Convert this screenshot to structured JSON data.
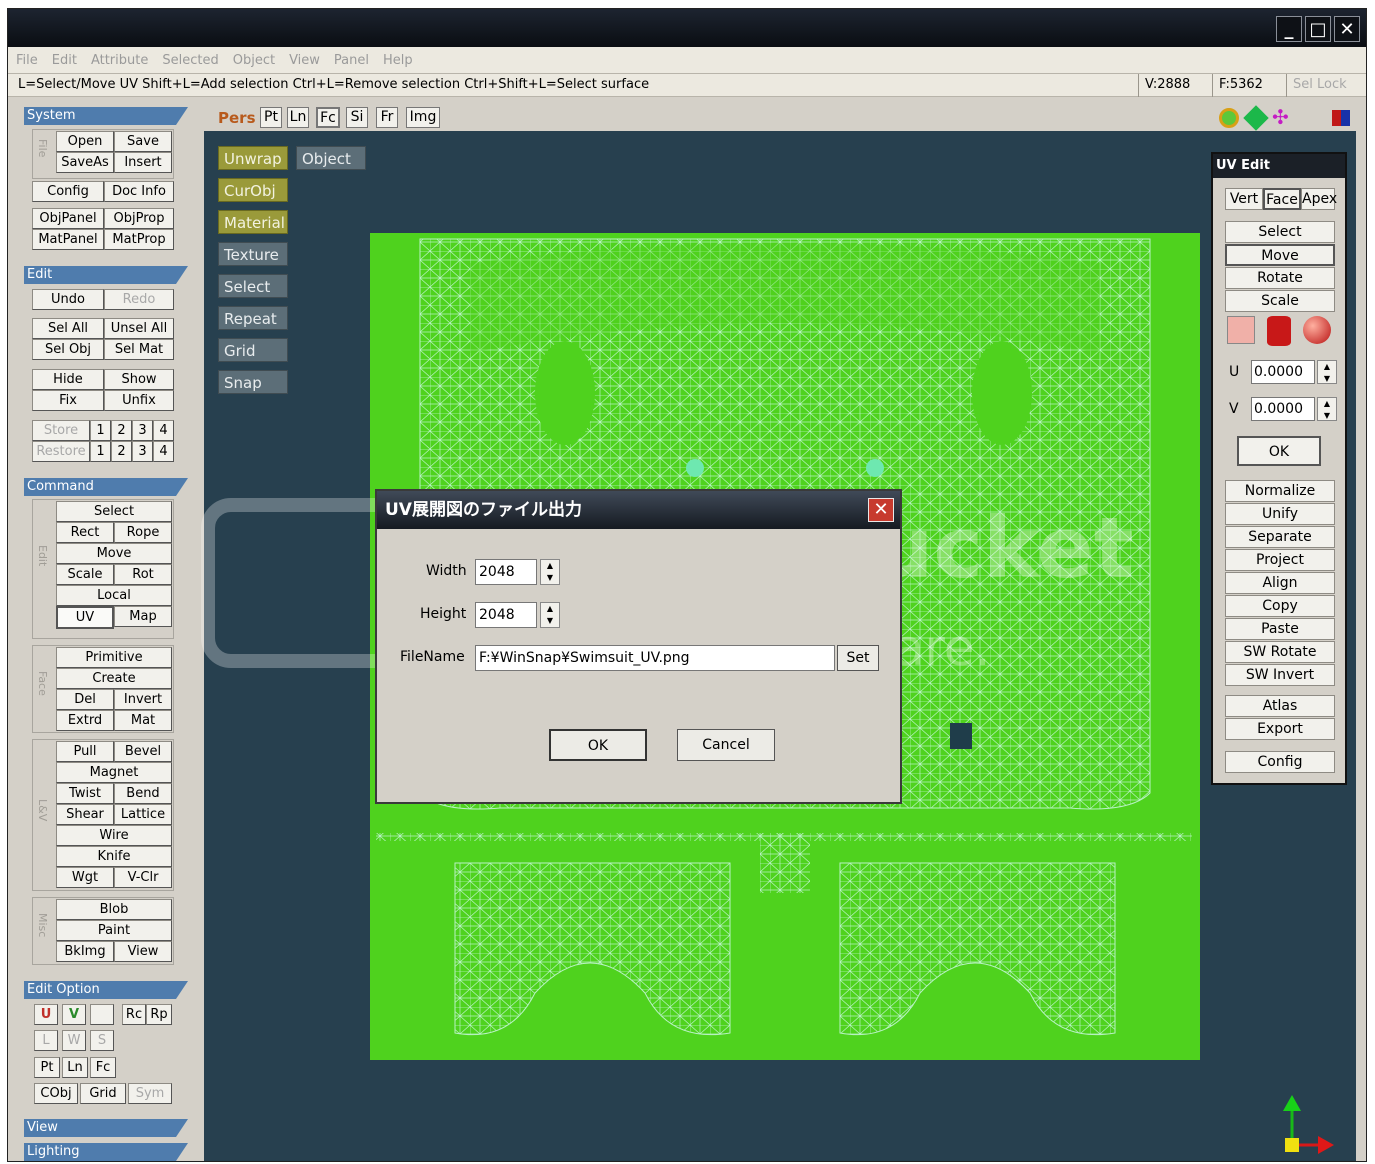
{
  "menu": [
    "File",
    "Edit",
    "Attribute",
    "Selected",
    "Object",
    "View",
    "Panel",
    "Help"
  ],
  "status": {
    "hint": "L=Select/Move UV  Shift+L=Add selection  Ctrl+L=Remove selection  Ctrl+Shift+L=Select surface",
    "verts": "V:2888",
    "faces": "F:5362",
    "lock": "Sel Lock"
  },
  "window_buttons": [
    "minimize-icon",
    "maximize-icon",
    "close-icon"
  ],
  "sections": {
    "system": "System",
    "edit": "Edit",
    "command": "Command",
    "edit_option": "Edit Option",
    "view": "View",
    "lighting": "Lighting"
  },
  "group_labels": {
    "file": "File",
    "edit": "Edit",
    "face": "Face",
    "lv": "L&V",
    "misc": "Misc"
  },
  "system_buttons": [
    "Open",
    "Save",
    "SaveAs",
    "Insert",
    "Config",
    "Doc Info",
    "ObjPanel",
    "ObjProp",
    "MatPanel",
    "MatProp"
  ],
  "edit_buttons": [
    "Undo",
    "Redo",
    "Sel All",
    "Unsel All",
    "Sel Obj",
    "Sel Mat",
    "Hide",
    "Show",
    "Fix",
    "Unfix",
    "Store",
    "1",
    "2",
    "3",
    "4",
    "Restore",
    "1",
    "2",
    "3",
    "4"
  ],
  "command_buttons": [
    "Select",
    "Rect",
    "Rope",
    "Move",
    "Scale",
    "Rot",
    "Local",
    "UV",
    "Map",
    "Primitive",
    "Create",
    "Del",
    "Invert",
    "Extrd",
    "Mat",
    "Pull",
    "Bevel",
    "Magnet",
    "Twist",
    "Bend",
    "Shear",
    "Lattice",
    "Wire",
    "Knife",
    "Wgt",
    "V-Clr",
    "Blob",
    "Paint",
    "BkImg",
    "View"
  ],
  "edit_option_buttons": [
    "U",
    "V",
    "",
    "Rc",
    "Rp",
    "L",
    "W",
    "S",
    "Pt",
    "Ln",
    "Fc",
    "CObj",
    "Grid",
    "Sym"
  ],
  "viewport_toolbar": {
    "mode": "Pers",
    "buttons": [
      "Pt",
      "Ln",
      "Fc",
      "Si",
      "Fr",
      "Img"
    ]
  },
  "viewport_buttons": [
    "Unwrap",
    "Object",
    "CurObj",
    "Material",
    "Texture",
    "Select",
    "Repeat",
    "Grid",
    "Snap"
  ],
  "viewport_icons": [
    "zoom-icon",
    "pan-icon",
    "rotate-icon",
    "color-icon"
  ],
  "uv_panel": {
    "title": "UV Edit",
    "tabs": [
      "Vert",
      "Face",
      "Apex"
    ],
    "tools": [
      "Select",
      "Move",
      "Rotate",
      "Scale"
    ],
    "u_label": "U",
    "u_value": "0.0000",
    "v_label": "V",
    "v_value": "0.0000",
    "ok": "OK",
    "actions": [
      "Normalize",
      "Unify",
      "Separate",
      "Project",
      "Align",
      "Copy",
      "Paste",
      "SW Rotate",
      "SW Invert",
      "Atlas",
      "Export",
      "Config"
    ]
  },
  "dialog": {
    "title": "UV展開図のファイル出力",
    "width_label": "Width",
    "width_value": "2048",
    "height_label": "Height",
    "height_value": "2048",
    "filename_label": "FileName",
    "filename_value": "F:¥WinSnap¥Swimsuit_UV.png",
    "set": "Set",
    "ok": "OK",
    "cancel": "Cancel"
  },
  "watermark": {
    "brand": "photobucket",
    "tagline": "host. store. share."
  },
  "colors": {
    "uv_bg": "#4fd21e",
    "wire": "#b8f2c4",
    "viewport": "#27404f",
    "section": "#4f7cad"
  }
}
